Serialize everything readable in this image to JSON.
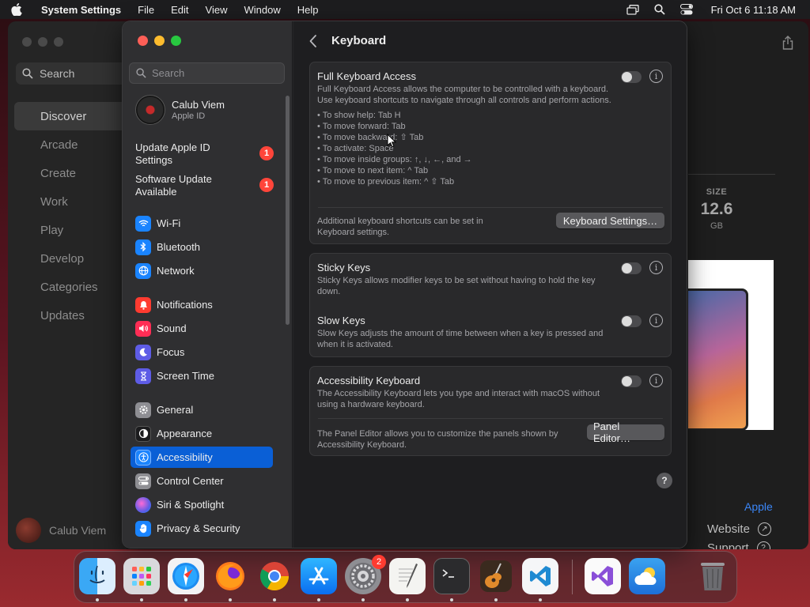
{
  "menubar": {
    "app_name": "System Settings",
    "menus": [
      "File",
      "Edit",
      "View",
      "Window",
      "Help"
    ],
    "clock": "Fri Oct 6  11:18 AM"
  },
  "background_window": {
    "search_placeholder": "Search",
    "nav": [
      "Discover",
      "Arcade",
      "Create",
      "Work",
      "Play",
      "Develop",
      "Categories",
      "Updates"
    ],
    "user_name": "Calub Viem",
    "size_label": "SIZE",
    "size_value": "12.6",
    "size_unit": "GB",
    "developer_link": "Apple",
    "website_label": "Website",
    "support_label": "Support"
  },
  "sidebar": {
    "search_placeholder": "Search",
    "profile": {
      "name": "Calub Viem",
      "subtitle": "Apple ID"
    },
    "notices": [
      {
        "label": "Update Apple ID Settings",
        "badge": "1"
      },
      {
        "label": "Software Update Available",
        "badge": "1"
      }
    ],
    "items": [
      {
        "label": "Wi-Fi",
        "icon": "wifi-icon",
        "color": "#1a84ff"
      },
      {
        "label": "Bluetooth",
        "icon": "bluetooth-icon",
        "color": "#1a84ff"
      },
      {
        "label": "Network",
        "icon": "globe-icon",
        "color": "#1a84ff"
      },
      {
        "label": "Notifications",
        "icon": "bell-icon",
        "color": "#ff3b30"
      },
      {
        "label": "Sound",
        "icon": "speaker-icon",
        "color": "#ff2d55"
      },
      {
        "label": "Focus",
        "icon": "moon-icon",
        "color": "#5e5ce6"
      },
      {
        "label": "Screen Time",
        "icon": "hourglass-icon",
        "color": "#5e5ce6"
      },
      {
        "label": "General",
        "icon": "gear-icon",
        "color": "#8e8e93"
      },
      {
        "label": "Appearance",
        "icon": "appearance-icon",
        "color": "#1c1c1e"
      },
      {
        "label": "Accessibility",
        "icon": "accessibility-icon",
        "color": "#1a84ff"
      },
      {
        "label": "Control Center",
        "icon": "control-center-icon",
        "color": "#8e8e93"
      },
      {
        "label": "Siri & Spotlight",
        "icon": "siri-icon",
        "color": "#bf5af2"
      },
      {
        "label": "Privacy & Security",
        "icon": "hand-icon",
        "color": "#1a84ff"
      }
    ],
    "active_item": "Accessibility"
  },
  "content": {
    "title": "Keyboard",
    "full_keyboard_access": {
      "title": "Full Keyboard Access",
      "description": "Full Keyboard Access allows the computer to be controlled with a keyboard. Use keyboard shortcuts to navigate through all controls and perform actions.",
      "shortcuts": [
        "• To show help: Tab H",
        "• To move forward: Tab",
        "• To move backward: ⇧ Tab",
        "• To activate: Space",
        "• To move inside groups: ↑, ↓, ←, and →",
        "• To move to next item: ^ Tab",
        "• To move to previous item: ^ ⇧ Tab"
      ],
      "footer": "Additional keyboard shortcuts can be set in Keyboard settings.",
      "button": "Keyboard Settings…",
      "enabled": false
    },
    "sticky_keys": {
      "title": "Sticky Keys",
      "description": "Sticky Keys allows modifier keys to be set without having to hold the key down.",
      "enabled": false
    },
    "slow_keys": {
      "title": "Slow Keys",
      "description": "Slow Keys adjusts the amount of time between when a key is pressed and when it is activated.",
      "enabled": false
    },
    "accessibility_keyboard": {
      "title": "Accessibility Keyboard",
      "description": "The Accessibility Keyboard lets you type and interact with macOS without using a hardware keyboard.",
      "footer": "The Panel Editor allows you to customize the panels shown by Accessibility Keyboard.",
      "button": "Panel Editor…",
      "enabled": false
    },
    "help": "?"
  },
  "dock": {
    "apps": [
      {
        "name": "Finder",
        "icon": "finder-icon"
      },
      {
        "name": "Launchpad",
        "icon": "launchpad-icon"
      },
      {
        "name": "Safari",
        "icon": "safari-icon"
      },
      {
        "name": "Firefox",
        "icon": "firefox-icon"
      },
      {
        "name": "Chrome",
        "icon": "chrome-icon"
      },
      {
        "name": "App Store",
        "icon": "app-store-icon"
      },
      {
        "name": "System Settings",
        "icon": "system-settings-icon",
        "badge": "2"
      },
      {
        "name": "TextEdit",
        "icon": "textedit-icon"
      },
      {
        "name": "Terminal",
        "icon": "terminal-icon"
      },
      {
        "name": "GarageBand",
        "icon": "garageband-icon"
      },
      {
        "name": "Visual Studio Code",
        "icon": "vscode-icon"
      },
      {
        "name": "Visual Studio",
        "icon": "visual-studio-icon"
      },
      {
        "name": "Weather",
        "icon": "weather-icon"
      },
      {
        "name": "Trash",
        "icon": "trash-icon"
      }
    ]
  }
}
